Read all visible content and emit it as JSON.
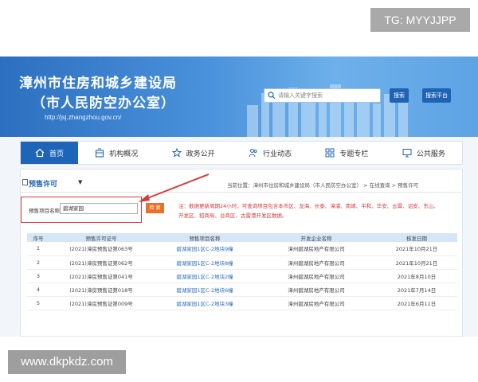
{
  "watermarks": {
    "top": "TG: MYYJJPP",
    "bottom": "www.dkpkdz.com"
  },
  "header": {
    "title_line1": "漳州市住房和城乡建设局",
    "title_line2": "（市人民防空办公室）",
    "url": "http://jsj.zhangzhou.gov.cn/",
    "search_placeholder": "请输入关键字搜索",
    "search_button": "搜索",
    "platform_button": "搜索平台"
  },
  "nav": {
    "items": [
      {
        "label": "首页",
        "icon": "home-icon",
        "active": true
      },
      {
        "label": "机构概况",
        "icon": "building-icon"
      },
      {
        "label": "政务公开",
        "icon": "star-icon"
      },
      {
        "label": "行业动态",
        "icon": "people-icon"
      },
      {
        "label": "专题专栏",
        "icon": "grid-icon"
      },
      {
        "label": "公共服务",
        "icon": "monitor-icon"
      }
    ]
  },
  "section": {
    "title": "预售许可",
    "breadcrumb": "当前位置：漳州市住房和城乡建设局（市人民防空办公室） > 在线查询 > 预售许可"
  },
  "filter": {
    "label": "预售项目名称",
    "value": "碧湖家园",
    "button": "检 索",
    "notice": "注：数据更新周期24小时，可查询项目包含本市区、龙海、长泰、漳浦、南靖、平和、华安、云霄、诏安、东山、开发区、招商局、台商区、古雷港开发区数据。"
  },
  "table": {
    "headers": [
      "序号",
      "预售许可证号",
      "预售项目名称",
      "开发企业名称",
      "核发日期"
    ],
    "rows": [
      [
        "1",
        "(2021)漳房预售证第063号",
        "碧湖家园1区C-2地块9幢",
        "漳州碧湖房地产有限公司",
        "2021年10月21日"
      ],
      [
        "2",
        "(2021)漳房预售证第062号",
        "碧湖家园1区C-2地块8幢",
        "漳州碧湖房地产有限公司",
        "2021年10月21日"
      ],
      [
        "3",
        "(2021)漳房预售证第041号",
        "碧湖家园1区C-2地块2幢",
        "漳州碧湖房地产有限公司",
        "2021年8月10日"
      ],
      [
        "4",
        "(2021)漳房预售证第018号",
        "碧湖家园1区C-2地块6幢",
        "漳州碧湖房地产有限公司",
        "2021年7月14日"
      ],
      [
        "5",
        "(2021)漳房预售证第009号",
        "碧湖家园1区C-2地块3幢",
        "漳州碧湖房地产有限公司",
        "2021年6月11日"
      ]
    ]
  },
  "colors": {
    "brand": "#1e64b8",
    "highlight": "#d83a3a",
    "button": "#e8722a"
  }
}
